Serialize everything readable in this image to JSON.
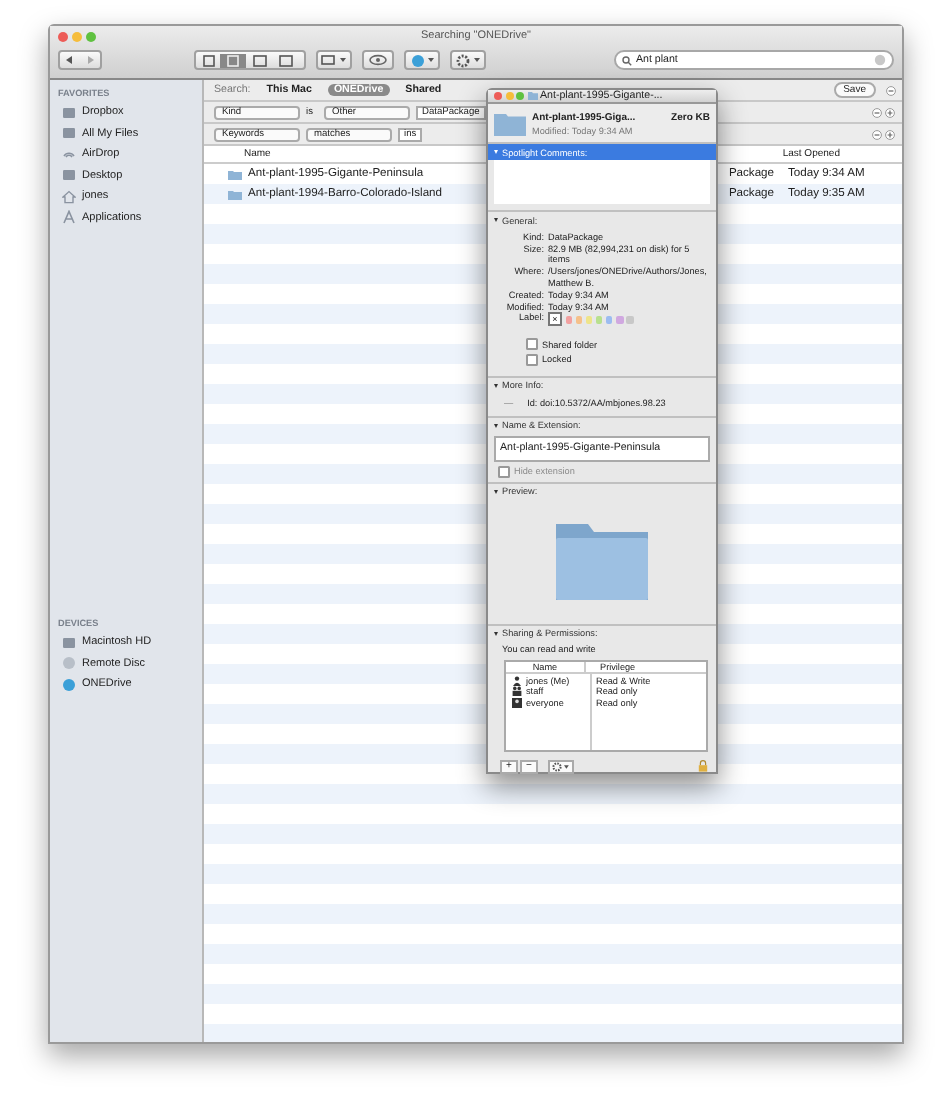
{
  "window": {
    "title": "Searching \"ONEDrive\""
  },
  "search_field": {
    "value": "Ant plant"
  },
  "sidebar": {
    "sections": [
      {
        "heading": "FAVORITES",
        "items": [
          {
            "label": "Dropbox",
            "kind": "dropbox",
            "selected": false
          },
          {
            "label": "All My Files",
            "kind": "files",
            "selected": false
          },
          {
            "label": "AirDrop",
            "kind": "airdrop",
            "selected": false
          },
          {
            "label": "Desktop",
            "kind": "desktop",
            "selected": false
          },
          {
            "label": "jones",
            "kind": "home",
            "selected": false
          },
          {
            "label": "Applications",
            "kind": "apps",
            "selected": false
          }
        ]
      },
      {
        "heading": "DEVICES",
        "items": [
          {
            "label": "Macintosh HD",
            "kind": "disk",
            "selected": false
          },
          {
            "label": "Remote Disc",
            "kind": "disc",
            "selected": false
          },
          {
            "label": "ONEDrive",
            "kind": "globe",
            "selected": false
          }
        ]
      }
    ]
  },
  "search_bar": {
    "label": "Search:",
    "scopes": [
      {
        "label": "This Mac",
        "selected": false
      },
      {
        "label": "ONEDrive",
        "selected": true
      },
      {
        "label": "Shared",
        "selected": false
      }
    ],
    "save": "Save"
  },
  "criteria": [
    {
      "fields": [
        {
          "kind": "popup",
          "text": "Kind"
        },
        {
          "kind": "text",
          "text": "is"
        },
        {
          "kind": "popup",
          "text": "Other"
        },
        {
          "kind": "field",
          "text": "DataPackage"
        }
      ]
    },
    {
      "fields": [
        {
          "kind": "popup",
          "text": "Keywords"
        },
        {
          "kind": "popup",
          "text": "matches"
        },
        {
          "kind": "field",
          "text": "ins"
        }
      ]
    }
  ],
  "table": {
    "columns": [
      "Name",
      "Last Opened"
    ],
    "rows": [
      {
        "name": "Ant-plant-1995-Gigante-Peninsula",
        "column_2": "Package",
        "last_opened": "Today 9:34 AM"
      },
      {
        "name": "Ant-plant-1994-Barro-Colorado-Island",
        "column_2": "Package",
        "last_opened": "Today 9:35 AM"
      }
    ]
  },
  "info_window": {
    "title": "Ant-plant-1995-Gigante-...",
    "name": "Ant-plant-1995-Giga...",
    "size": "Zero KB",
    "modified": "Modified: Today 9:34 AM",
    "spotlight": {
      "heading": "Spotlight Comments:",
      "selected": true
    },
    "general": {
      "heading": "General:",
      "rows": [
        {
          "label": "Kind:",
          "value": "DataPackage"
        },
        {
          "label": "Size:",
          "value": "82.9 MB (82,994,231 on disk) for 5 items"
        },
        {
          "label": "Where:",
          "value": "/Users/jones/ONEDrive/Authors/Jones, Matthew B."
        },
        {
          "label": "Created:",
          "value": "Today 9:34 AM"
        },
        {
          "label": "Modified:",
          "value": "Today 9:34 AM"
        }
      ],
      "label_caption": "Label:",
      "label_none": {
        "symbol": "×",
        "selected": true
      },
      "label_colors": [
        {
          "color": "#f2a0a0",
          "selected": false
        },
        {
          "color": "#f5c08a",
          "selected": false
        },
        {
          "color": "#eee48a",
          "selected": false
        },
        {
          "color": "#b8e08e",
          "selected": false
        },
        {
          "color": "#9cbcf0",
          "selected": false
        },
        {
          "color": "#d0a8e0",
          "selected": false
        },
        {
          "color": "#c8c8c8",
          "selected": false
        }
      ],
      "checkboxes": [
        {
          "label": "Shared folder",
          "checked": false
        },
        {
          "label": "Locked",
          "checked": false
        }
      ]
    },
    "more_info": {
      "heading": "More Info:",
      "dash": "—",
      "id": "Id: doi:10.5372/AA/mbjones.98.23"
    },
    "name_ext": {
      "heading": "Name & Extension:",
      "value": "Ant-plant-1995-Gigante-Peninsula",
      "hide_extension": {
        "label": "Hide extension",
        "checked": false,
        "disabled": true
      }
    },
    "preview": {
      "heading": "Preview:"
    },
    "sharing": {
      "heading": "Sharing & Permissions:",
      "note": "You can read and write",
      "columns": [
        "Name",
        "Privilege"
      ],
      "rows": [
        {
          "name": "jones (Me)",
          "kind": "user",
          "privilege": "Read & Write"
        },
        {
          "name": "staff",
          "kind": "group",
          "privilege": "Read only"
        },
        {
          "name": "everyone",
          "kind": "everyone",
          "privilege": "Read only"
        }
      ],
      "add": "+",
      "remove": "−"
    }
  }
}
